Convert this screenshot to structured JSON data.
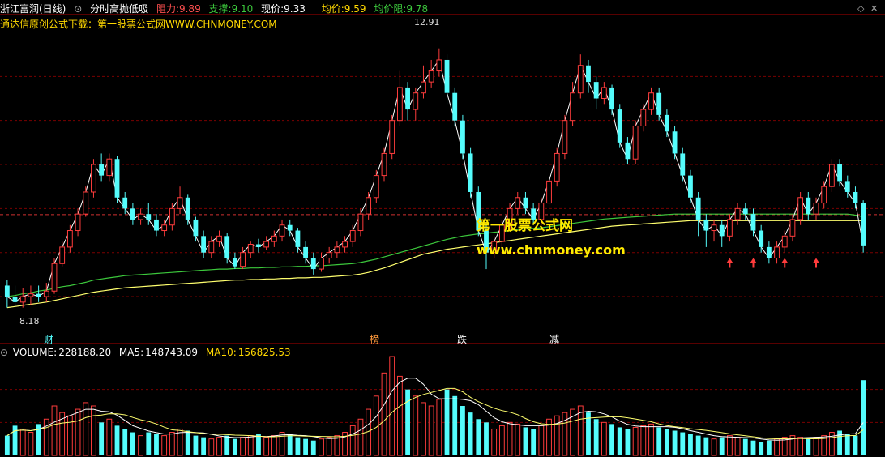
{
  "header": {
    "stock_name": "浙江富润(日线)",
    "indicator_name": "分时高抛低吸",
    "resistance_label": "阻力:",
    "resistance_value": "9.89",
    "support_label": "支撑:",
    "support_value": "9.10",
    "current_label": "现价:",
    "current_value": "9.33",
    "avg_label": "均价:",
    "avg_value": "9.59",
    "avg_limit_label": "均价限:",
    "avg_limit_value": "9.78"
  },
  "subheader": {
    "text": "通达信原创公式下载：第一股票公式网WWW.CHNMONEY.COM"
  },
  "watermark": {
    "line1": "第一股票公式网",
    "line2": "www.chnmoney.com"
  },
  "annotations": {
    "high_label": "12.91",
    "low_label": "8.18",
    "marks": [
      "财",
      "榜",
      "跌",
      "减"
    ]
  },
  "volume_header": {
    "volume_label": "VOLUME:",
    "volume_value": "228188.20",
    "ma5_label": "MA5:",
    "ma5_value": "148743.09",
    "ma10_label": "MA10:",
    "ma10_value": "156825.53"
  },
  "colors": {
    "up": "#ff3c3c",
    "down": "#54fcfc",
    "white": "#ffffff",
    "green": "#3cc83c",
    "yellow": "#ffff6e",
    "pink": "#ff78c8",
    "olive": "#8aa000"
  },
  "chart_data": {
    "type": "candlestick",
    "ylim": [
      7.9,
      13.2
    ],
    "support": 9.1,
    "resistance": 9.89,
    "candles": [
      [
        8.6,
        8.4,
        8.7,
        8.2
      ],
      [
        8.4,
        8.3,
        8.6,
        8.2
      ],
      [
        8.3,
        8.4,
        8.55,
        8.2
      ],
      [
        8.4,
        8.45,
        8.6,
        8.25
      ],
      [
        8.45,
        8.4,
        8.6,
        8.3
      ],
      [
        8.4,
        8.5,
        8.65,
        8.3
      ],
      [
        8.5,
        9.0,
        9.1,
        8.45
      ],
      [
        9.0,
        9.3,
        9.4,
        8.95
      ],
      [
        9.3,
        9.6,
        9.7,
        9.2
      ],
      [
        9.6,
        9.9,
        10.0,
        9.5
      ],
      [
        9.9,
        10.3,
        10.4,
        9.85
      ],
      [
        10.3,
        10.8,
        10.9,
        10.2
      ],
      [
        10.8,
        10.6,
        11.0,
        10.5
      ],
      [
        10.6,
        10.9,
        11.0,
        10.5
      ],
      [
        10.9,
        10.2,
        10.95,
        10.1
      ],
      [
        10.2,
        10.0,
        10.3,
        9.9
      ],
      [
        10.0,
        9.8,
        10.1,
        9.7
      ],
      [
        9.8,
        9.9,
        10.0,
        9.7
      ],
      [
        9.9,
        9.8,
        10.1,
        9.7
      ],
      [
        9.8,
        9.6,
        9.9,
        9.5
      ],
      [
        9.6,
        9.7,
        9.8,
        9.5
      ],
      [
        9.7,
        10.0,
        10.1,
        9.6
      ],
      [
        10.0,
        10.2,
        10.4,
        9.9
      ],
      [
        10.2,
        9.8,
        10.25,
        9.7
      ],
      [
        9.8,
        9.5,
        9.85,
        9.4
      ],
      [
        9.5,
        9.2,
        9.6,
        9.1
      ],
      [
        9.2,
        9.4,
        9.5,
        9.1
      ],
      [
        9.4,
        9.5,
        9.6,
        9.3
      ],
      [
        9.5,
        9.1,
        9.55,
        9.0
      ],
      [
        9.1,
        8.95,
        9.2,
        8.9
      ],
      [
        8.95,
        9.2,
        9.3,
        8.9
      ],
      [
        9.2,
        9.35,
        9.4,
        9.1
      ],
      [
        9.35,
        9.3,
        9.45,
        9.2
      ],
      [
        9.3,
        9.4,
        9.5,
        9.25
      ],
      [
        9.4,
        9.5,
        9.6,
        9.3
      ],
      [
        9.5,
        9.7,
        9.8,
        9.4
      ],
      [
        9.7,
        9.6,
        9.8,
        9.5
      ],
      [
        9.6,
        9.3,
        9.65,
        9.2
      ],
      [
        9.3,
        9.1,
        9.4,
        9.0
      ],
      [
        9.1,
        8.9,
        9.2,
        8.8
      ],
      [
        8.9,
        9.1,
        9.2,
        8.85
      ],
      [
        9.1,
        9.2,
        9.3,
        9.0
      ],
      [
        9.2,
        9.3,
        9.4,
        9.1
      ],
      [
        9.3,
        9.4,
        9.5,
        9.2
      ],
      [
        9.4,
        9.6,
        9.7,
        9.3
      ],
      [
        9.6,
        9.9,
        10.0,
        9.5
      ],
      [
        9.9,
        10.2,
        10.3,
        9.8
      ],
      [
        10.2,
        10.6,
        10.7,
        10.1
      ],
      [
        10.6,
        11.0,
        11.1,
        10.5
      ],
      [
        11.0,
        11.6,
        11.7,
        10.9
      ],
      [
        11.6,
        12.2,
        12.5,
        11.5
      ],
      [
        12.2,
        11.8,
        12.3,
        11.6
      ],
      [
        11.8,
        12.1,
        12.2,
        11.6
      ],
      [
        12.1,
        12.3,
        12.6,
        12.0
      ],
      [
        12.3,
        12.5,
        12.7,
        12.2
      ],
      [
        12.5,
        12.7,
        12.91,
        12.4
      ],
      [
        12.7,
        12.1,
        12.8,
        11.9
      ],
      [
        12.1,
        11.6,
        12.2,
        11.5
      ],
      [
        11.6,
        11.0,
        11.7,
        10.9
      ],
      [
        11.0,
        10.3,
        11.1,
        10.2
      ],
      [
        10.3,
        9.6,
        10.4,
        9.5
      ],
      [
        9.6,
        9.2,
        9.7,
        8.9
      ],
      [
        9.2,
        9.4,
        9.5,
        9.1
      ],
      [
        9.4,
        9.7,
        9.8,
        9.3
      ],
      [
        9.7,
        10.0,
        10.1,
        9.6
      ],
      [
        10.0,
        10.2,
        10.3,
        9.9
      ],
      [
        10.2,
        10.0,
        10.3,
        9.9
      ],
      [
        10.0,
        9.8,
        10.1,
        9.7
      ],
      [
        9.8,
        10.1,
        10.2,
        9.7
      ],
      [
        10.1,
        10.5,
        10.6,
        10.0
      ],
      [
        10.5,
        11.0,
        11.1,
        10.4
      ],
      [
        11.0,
        11.6,
        11.7,
        10.9
      ],
      [
        11.6,
        12.1,
        12.3,
        11.5
      ],
      [
        12.1,
        12.6,
        12.8,
        12.0
      ],
      [
        12.6,
        12.3,
        12.7,
        12.1
      ],
      [
        12.3,
        12.0,
        12.4,
        11.8
      ],
      [
        12.0,
        12.2,
        12.3,
        11.9
      ],
      [
        12.2,
        11.8,
        12.25,
        11.7
      ],
      [
        11.8,
        11.2,
        11.9,
        11.1
      ],
      [
        11.2,
        10.9,
        11.3,
        10.8
      ],
      [
        10.9,
        11.5,
        11.6,
        10.8
      ],
      [
        11.5,
        11.8,
        11.9,
        11.4
      ],
      [
        11.8,
        12.1,
        12.2,
        11.7
      ],
      [
        12.1,
        11.7,
        12.2,
        11.6
      ],
      [
        11.7,
        11.4,
        11.8,
        11.3
      ],
      [
        11.4,
        11.0,
        11.5,
        10.9
      ],
      [
        11.0,
        10.6,
        11.1,
        10.5
      ],
      [
        10.6,
        10.2,
        10.7,
        10.1
      ],
      [
        10.2,
        9.8,
        10.3,
        9.5
      ],
      [
        9.8,
        9.6,
        9.9,
        9.3
      ],
      [
        9.6,
        9.7,
        9.8,
        9.4
      ],
      [
        9.7,
        9.5,
        9.8,
        9.3
      ],
      [
        9.5,
        9.8,
        9.9,
        9.4
      ],
      [
        9.8,
        10.0,
        10.1,
        9.7
      ],
      [
        10.0,
        9.9,
        10.1,
        9.8
      ],
      [
        9.9,
        9.6,
        10.0,
        9.5
      ],
      [
        9.6,
        9.3,
        9.7,
        9.2
      ],
      [
        9.3,
        9.1,
        9.4,
        9.0
      ],
      [
        9.1,
        9.3,
        9.4,
        9.0
      ],
      [
        9.3,
        9.5,
        9.6,
        9.2
      ],
      [
        9.5,
        9.8,
        9.9,
        9.4
      ],
      [
        9.8,
        10.2,
        10.3,
        9.7
      ],
      [
        10.2,
        9.9,
        10.3,
        9.8
      ],
      [
        9.9,
        10.1,
        10.2,
        9.8
      ],
      [
        10.1,
        10.4,
        10.5,
        10.0
      ],
      [
        10.4,
        10.8,
        10.9,
        10.3
      ],
      [
        10.8,
        10.5,
        10.9,
        10.4
      ],
      [
        10.5,
        10.3,
        10.6,
        10.2
      ],
      [
        10.3,
        10.1,
        10.4,
        10.0
      ],
      [
        10.1,
        9.33,
        10.15,
        9.2
      ]
    ],
    "ma_green": [
      8.4,
      8.42,
      8.45,
      8.47,
      8.5,
      8.52,
      8.55,
      8.58,
      8.6,
      8.63,
      8.66,
      8.7,
      8.72,
      8.74,
      8.76,
      8.78,
      8.79,
      8.8,
      8.81,
      8.82,
      8.83,
      8.84,
      8.85,
      8.86,
      8.87,
      8.88,
      8.89,
      8.9,
      8.9,
      8.91,
      8.91,
      8.92,
      8.92,
      8.93,
      8.93,
      8.94,
      8.94,
      8.95,
      8.95,
      8.96,
      8.96,
      8.97,
      8.98,
      8.99,
      9.0,
      9.02,
      9.05,
      9.08,
      9.12,
      9.16,
      9.2,
      9.24,
      9.28,
      9.32,
      9.36,
      9.4,
      9.44,
      9.47,
      9.5,
      9.52,
      9.54,
      9.55,
      9.57,
      9.58,
      9.6,
      9.62,
      9.63,
      9.64,
      9.65,
      9.67,
      9.69,
      9.71,
      9.73,
      9.75,
      9.77,
      9.79,
      9.81,
      9.82,
      9.83,
      9.84,
      9.85,
      9.86,
      9.87,
      9.88,
      9.89,
      9.9,
      9.9,
      9.9,
      9.9,
      9.9,
      9.9,
      9.9,
      9.9,
      9.9,
      9.9,
      9.9,
      9.9,
      9.9,
      9.9,
      9.9,
      9.9,
      9.9,
      9.9,
      9.9,
      9.9,
      9.9,
      9.9,
      9.9,
      9.88,
      9.85
    ],
    "ma_yellow": [
      8.2,
      8.22,
      8.24,
      8.26,
      8.28,
      8.3,
      8.33,
      8.36,
      8.39,
      8.42,
      8.45,
      8.48,
      8.5,
      8.52,
      8.54,
      8.56,
      8.57,
      8.58,
      8.59,
      8.6,
      8.61,
      8.62,
      8.63,
      8.64,
      8.65,
      8.66,
      8.67,
      8.68,
      8.69,
      8.7,
      8.7,
      8.71,
      8.71,
      8.72,
      8.72,
      8.73,
      8.73,
      8.74,
      8.74,
      8.75,
      8.75,
      8.76,
      8.77,
      8.78,
      8.79,
      8.81,
      8.84,
      8.88,
      8.92,
      8.97,
      9.02,
      9.07,
      9.12,
      9.17,
      9.2,
      9.23,
      9.26,
      9.28,
      9.3,
      9.32,
      9.34,
      9.36,
      9.38,
      9.4,
      9.42,
      9.44,
      9.46,
      9.48,
      9.5,
      9.52,
      9.54,
      9.56,
      9.58,
      9.6,
      9.62,
      9.64,
      9.66,
      9.68,
      9.69,
      9.7,
      9.71,
      9.72,
      9.73,
      9.74,
      9.75,
      9.76,
      9.77,
      9.78,
      9.78,
      9.78,
      9.78,
      9.78,
      9.78,
      9.78,
      9.78,
      9.78,
      9.78,
      9.78,
      9.78,
      9.78,
      9.78,
      9.78,
      9.78,
      9.78,
      9.78,
      9.78,
      9.78,
      9.78,
      9.78,
      9.78
    ],
    "volume_ylim": [
      0,
      300000
    ],
    "volume": [
      60000,
      90000,
      80000,
      70000,
      95000,
      110000,
      150000,
      130000,
      120000,
      140000,
      160000,
      150000,
      100000,
      110000,
      90000,
      80000,
      70000,
      60000,
      70000,
      65000,
      60000,
      70000,
      80000,
      75000,
      60000,
      55000,
      50000,
      55000,
      60000,
      50000,
      55000,
      60000,
      65000,
      55000,
      60000,
      70000,
      65000,
      55000,
      50000,
      45000,
      50000,
      55000,
      60000,
      70000,
      90000,
      110000,
      140000,
      180000,
      250000,
      300000,
      240000,
      200000,
      180000,
      160000,
      150000,
      170000,
      200000,
      180000,
      150000,
      130000,
      110000,
      100000,
      80000,
      90000,
      100000,
      95000,
      85000,
      80000,
      90000,
      110000,
      120000,
      130000,
      140000,
      150000,
      130000,
      110000,
      100000,
      95000,
      85000,
      80000,
      85000,
      90000,
      95000,
      85000,
      80000,
      75000,
      70000,
      65000,
      60000,
      55000,
      50000,
      55000,
      60000,
      55000,
      50000,
      45000,
      40000,
      45000,
      50000,
      55000,
      60000,
      55000,
      50000,
      55000,
      60000,
      70000,
      75000,
      65000,
      60000,
      228188.2
    ]
  }
}
